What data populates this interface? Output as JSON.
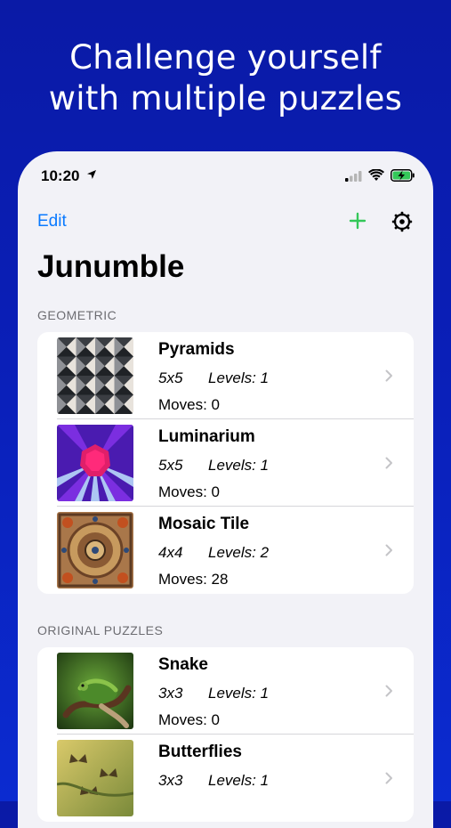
{
  "promo": {
    "headline_line1": "Challenge yourself",
    "headline_line2": "with multiple puzzles"
  },
  "status_bar": {
    "time": "10:20",
    "icons": [
      "location-arrow-icon",
      "cellular-signal-icon",
      "wifi-icon",
      "battery-charging-icon"
    ]
  },
  "nav": {
    "edit_label": "Edit",
    "add_icon": "plus-icon",
    "settings_icon": "gear-icon",
    "title": "Junumble"
  },
  "colors": {
    "background": "#0a1fb8",
    "accent_blue": "#0a7aff",
    "accent_green": "#34c759"
  },
  "sections": [
    {
      "header": "GEOMETRIC",
      "items": [
        {
          "name": "Pyramids",
          "size": "5x5",
          "levels": "Levels: 1",
          "moves": "Moves: 0"
        },
        {
          "name": "Luminarium",
          "size": "5x5",
          "levels": "Levels: 1",
          "moves": "Moves: 0"
        },
        {
          "name": "Mosaic Tile",
          "size": "4x4",
          "levels": "Levels: 2",
          "moves": "Moves: 28"
        }
      ]
    },
    {
      "header": "ORIGINAL PUZZLES",
      "items": [
        {
          "name": "Snake",
          "size": "3x3",
          "levels": "Levels: 1",
          "moves": "Moves: 0"
        },
        {
          "name": "Butterflies",
          "size": "3x3",
          "levels": "Levels: 1",
          "moves": ""
        }
      ]
    }
  ]
}
